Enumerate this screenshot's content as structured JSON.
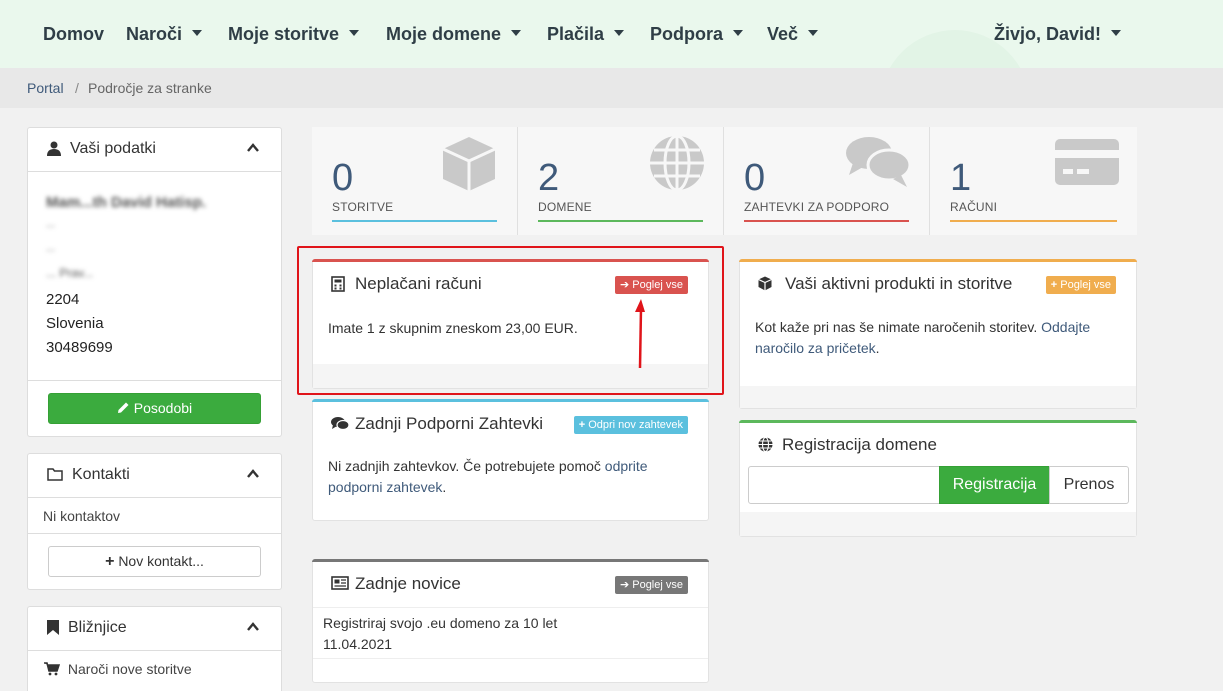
{
  "nav": {
    "items": [
      "Domov",
      "Naroči",
      "Moje storitve",
      "Moje domene",
      "Plačila",
      "Podpora",
      "Več"
    ],
    "user": "Živjo, David!"
  },
  "breadcrumb": {
    "root": "Portal",
    "separator": "/",
    "current": "Področje za stranke"
  },
  "sidebar": {
    "your_data": {
      "title": "Vaši podatki",
      "address_lines": [
        "Mam...th David Hatisp.",
        "...",
        "...",
        "... Prav...",
        "2204",
        "Slovenia",
        "30489699"
      ],
      "update_button": "Posodobi"
    },
    "contacts": {
      "title": "Kontakti",
      "empty": "Ni kontaktov",
      "new_button": "Nov kontakt..."
    },
    "shortcuts": {
      "title": "Bližnjice",
      "items": [
        "Naroči nove storitve"
      ]
    }
  },
  "tiles": [
    {
      "value": "0",
      "label": "STORITVE",
      "color": "#5bc0de",
      "icon": "cube-icon"
    },
    {
      "value": "2",
      "label": "DOMENE",
      "color": "#5cb85c",
      "icon": "globe-icon"
    },
    {
      "value": "0",
      "label": "ZAHTEVKI ZA PODPORO",
      "color": "#d9534f",
      "icon": "comments-icon"
    },
    {
      "value": "1",
      "label": "RAČUNI",
      "color": "#f0ad4e",
      "icon": "credit-card-icon"
    }
  ],
  "cards": {
    "unpaid": {
      "title": "Neplačani računi",
      "badge": "Poglej vse",
      "body": "Imate 1 z skupnim zneskom 23,00 EUR.",
      "accent": "#d9534f"
    },
    "tickets": {
      "title": "Zadnji Podporni Zahtevki",
      "badge": "Odpri nov zahtevek",
      "body_text": "Ni zadnjih zahtevkov. Če potrebujete pomoč ",
      "body_link": "odprite podporni zahtevek",
      "body_end": ".",
      "accent": "#5bc0de"
    },
    "news": {
      "title": "Zadnje novice",
      "badge": "Poglej vse",
      "item_title": "Registriraj svojo .eu domeno za 10 let",
      "item_date": "11.04.2021",
      "accent": "#777777"
    },
    "products": {
      "title": "Vaši aktivni produkti in storitve",
      "badge": "Poglej vse",
      "body_text": "Kot kaže pri nas še nimate naročenih storitev. ",
      "body_link": "Oddajte naročilo za pričetek",
      "body_end": ".",
      "accent": "#f0ad4e"
    },
    "domain": {
      "title": "Registracija domene",
      "register_button": "Registracija",
      "transfer_button": "Prenos",
      "accent": "#5cb85c"
    }
  }
}
